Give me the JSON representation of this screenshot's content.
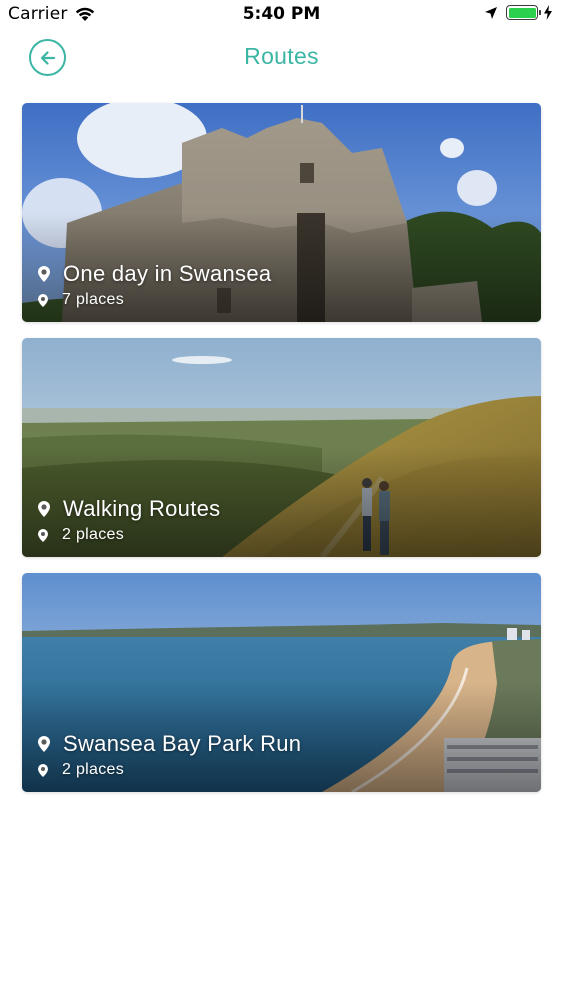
{
  "status_bar": {
    "carrier": "Carrier",
    "time": "5:40 PM",
    "battery_level": 1.0,
    "charging": true
  },
  "nav": {
    "title": "Routes",
    "back_icon": "arrow-left-icon",
    "accent_color": "#3bb5a4"
  },
  "routes": [
    {
      "title": "One day in Swansea",
      "places": "7 places",
      "image": "castle-ruins"
    },
    {
      "title": "Walking Routes",
      "places": "2 places",
      "image": "hillside-walkers"
    },
    {
      "title": "Swansea Bay Park Run",
      "places": "2 places",
      "image": "bay-coastline"
    }
  ]
}
